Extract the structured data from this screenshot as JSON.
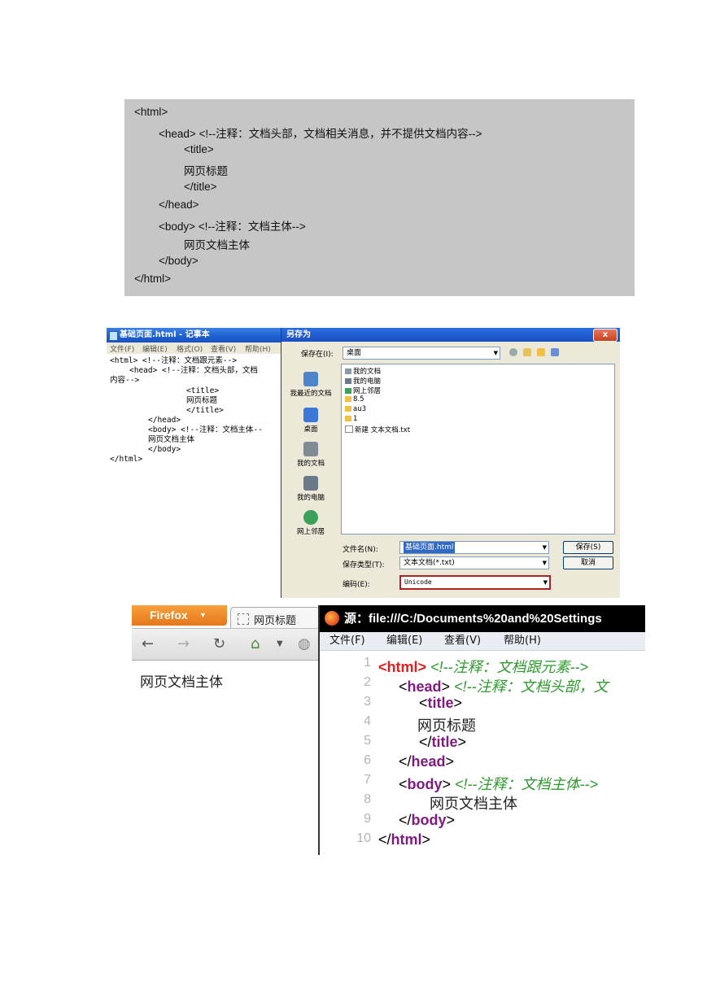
{
  "code_block": {
    "lines": [
      "<html>",
      "<head> <!--注释：文档头部，文档相关消息，并不提供文档内容-->",
      "<title>",
      "网页标题",
      "</title>",
      "</head>",
      "<body> <!--注释：文档主体-->",
      "网页文档主体",
      "</body>",
      "</html>"
    ]
  },
  "notepad": {
    "title": "基础页面.html - 记事本",
    "menu": [
      "文件(F)",
      "编辑(E)",
      "格式(O)",
      "查看(V)",
      "帮助(H)"
    ],
    "lines": [
      "<html> <!--注释：文档跟元素-->",
      "<head> <!--注释：文档头部，文档",
      "内容-->",
      "<title>",
      "网页标题",
      "</title>",
      "</head>",
      "<body> <!--注释：文档主体--",
      "网页文档主体",
      "</body>",
      "</html>"
    ]
  },
  "save_dialog": {
    "title": "另存为",
    "close": "x",
    "save_in_label": "保存在(I):",
    "save_in_value": "桌面",
    "places": [
      "我最近的文档",
      "桌面",
      "我的文档",
      "我的电脑",
      "网上邻居"
    ],
    "files": [
      "我的文档",
      "我的电脑",
      "网上邻居",
      "8.5",
      "au3",
      "1",
      "新建 文本文档.txt"
    ],
    "filename_label": "文件名(N):",
    "filename_value": "基础页面.html",
    "filetype_label": "保存类型(T):",
    "filetype_value": "文本文档(*.txt)",
    "encoding_label": "编码(E):",
    "encoding_value": "Unicode",
    "save_button": "保存(S)",
    "cancel_button": "取消"
  },
  "firefox": {
    "menu_button": "Firefox",
    "tab_title": "网页标题",
    "body_text": "网页文档主体"
  },
  "source_view": {
    "title": "源：file:///C:/Documents%20and%20Settings",
    "menu": [
      "文件(F)",
      "编辑(E)",
      "查看(V)",
      "帮助(H)"
    ],
    "line_numbers": [
      "1",
      "2",
      "3",
      "4",
      "5",
      "6",
      "7",
      "8",
      "9",
      "10"
    ],
    "l1_tag": "<html>",
    "l1_comment": "<!--注释：文档跟元素-->",
    "l2_lt": "<",
    "l2_tag": "head",
    "l2_gt": ">",
    "l2_comment": "<!--注释：文档头部，文",
    "l3_lt": "<",
    "l3_tag": "title",
    "l3_gt": ">",
    "l4_text": "网页标题",
    "l5_lt": "</",
    "l5_tag": "title",
    "l5_gt": ">",
    "l6_lt": "</",
    "l6_tag": "head",
    "l6_gt": ">",
    "l7_lt": "<",
    "l7_tag": "body",
    "l7_gt": ">",
    "l7_comment": "<!--注释：文档主体-->",
    "l8_text": "网页文档主体",
    "l9_lt": "</",
    "l9_tag": "body",
    "l9_gt": ">",
    "l10_lt": "</",
    "l10_tag": "html",
    "l10_gt": ">"
  }
}
